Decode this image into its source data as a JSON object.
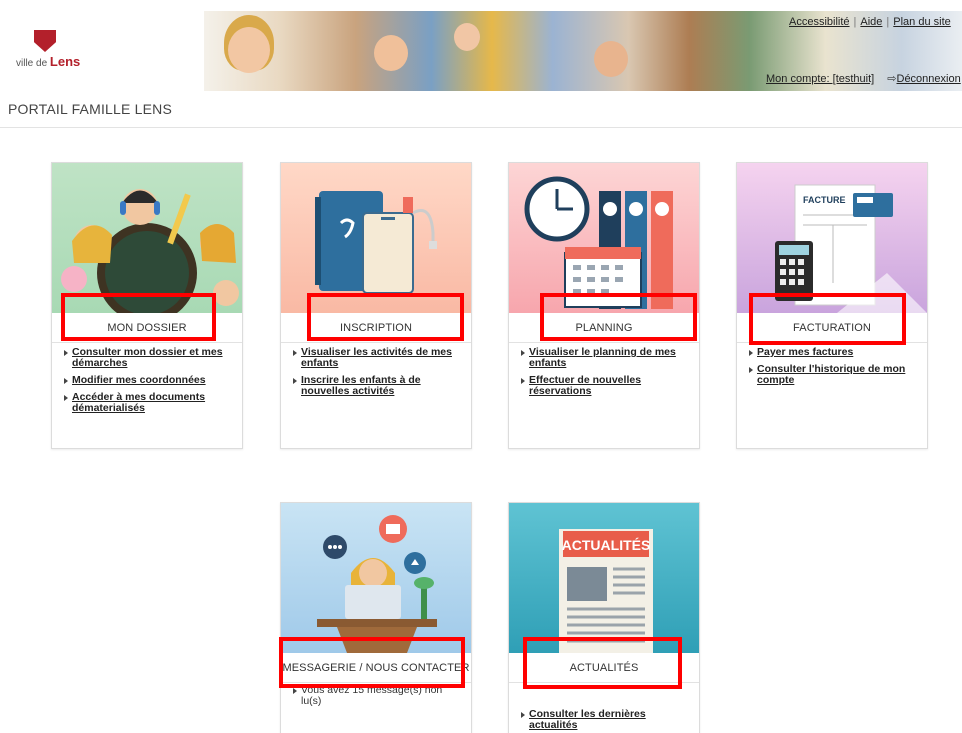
{
  "header": {
    "logo_prefix": "ville de",
    "logo_name": "Lens",
    "links": [
      "Accessibilité",
      "Aide",
      "Plan du site"
    ],
    "account_label": "Mon compte: [testhuit]",
    "logout_label": "Déconnexion"
  },
  "portal_title": "PORTAIL FAMILLE LENS",
  "cards": [
    {
      "title": "MON DOSSIER",
      "links": [
        "Consulter mon dossier et mes démarches",
        "Modifier mes coordonnées",
        "Accéder à mes documents dématerialisés"
      ]
    },
    {
      "title": "INSCRIPTION",
      "links": [
        "Visualiser les activités de mes enfants",
        "Inscrire les enfants à de nouvelles activités"
      ]
    },
    {
      "title": "PLANNING",
      "links": [
        "Visualiser le planning de mes enfants",
        "Effectuer de nouvelles réservations"
      ]
    },
    {
      "title": "FACTURATION",
      "links": [
        "Payer mes factures",
        "Consulter l'historique de mon compte"
      ]
    },
    {
      "title": "MESSAGERIE / NOUS CONTACTER",
      "info": "Vous avez 15 message(s) non lu(s)"
    },
    {
      "title": "ACTUALITÉS",
      "links": [
        "Consulter les dernières actualités"
      ]
    }
  ],
  "illustrations": {
    "facture_text": "FACTURE",
    "actualites_text": "ACTUALITÉS"
  },
  "colors": {
    "highlight": "#ff0000",
    "brand": "#b3202b"
  }
}
